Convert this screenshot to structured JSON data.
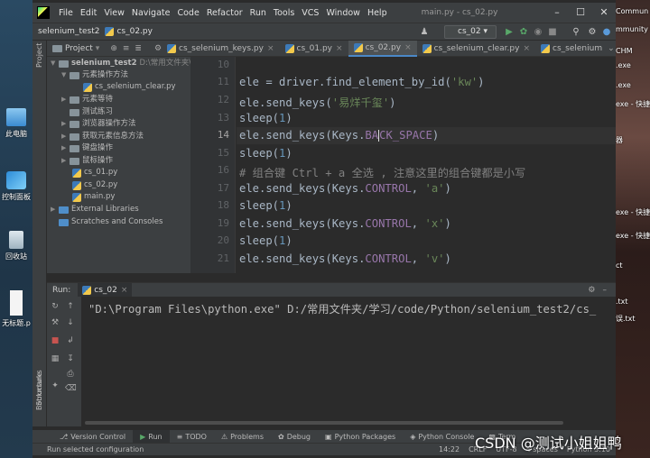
{
  "desktop": {
    "icons": [
      {
        "label": "此电脑"
      },
      {
        "label": "控制面板"
      },
      {
        "label": "回收站"
      },
      {
        "label": "无标题.p"
      }
    ],
    "right_snippets": [
      "Commun",
      "mmunity I",
      "CHM",
      ".exe",
      ".exe",
      "exe - 快捷方",
      "器",
      "exe - 快捷方",
      "exe - 快捷方",
      "ct",
      ".txt",
      "误.txt"
    ]
  },
  "window": {
    "title": "main.py - cs_02.py",
    "menu": [
      "File",
      "Edit",
      "View",
      "Navigate",
      "Code",
      "Refactor",
      "Run",
      "Tools",
      "VCS",
      "Window",
      "Help"
    ]
  },
  "nav": {
    "project": "selenium_test2",
    "file": "cs_02.py",
    "run_config": "cs_02"
  },
  "tabs": {
    "project_label": "Project",
    "editor_tabs": [
      "cs_selenium_keys.py",
      "cs_01.py",
      "cs_02.py",
      "cs_selenium_clear.py",
      "cs_selenium"
    ],
    "active": "cs_02.py"
  },
  "tree": {
    "root": "selenium_test2",
    "root_path": "D:\\常用文件夹\\学习",
    "items": [
      "元素操作方法",
      "cs_selenium_clear.py",
      "元素等待",
      "测试练习",
      "浏览器操作方法",
      "获取元素信息方法",
      "键盘操作",
      "鼠标操作",
      "cs_01.py",
      "cs_02.py",
      "main.py",
      "External Libraries",
      "Scratches and Consoles"
    ]
  },
  "editor": {
    "line_numbers": [
      "10",
      "11",
      "12",
      "13",
      "14",
      "15",
      "16",
      "17",
      "18",
      "19",
      "20",
      "21"
    ],
    "lines": [
      "",
      "ele = driver.find_element_by_id('kw')",
      "ele.send_keys('易烊千玺')",
      "sleep(1)",
      "ele.send_keys(Keys.BACK_SPACE)",
      "sleep(1)",
      "# 组合键 Ctrl + a 全选 , 注意这里的组合键都是小写",
      "ele.send_keys(Keys.CONTROL, 'a')",
      "sleep(1)",
      "ele.send_keys(Keys.CONTROL, 'x')",
      "sleep(1)",
      "ele.send_keys(Keys.CONTROL, 'v')"
    ],
    "current_line": "14"
  },
  "run": {
    "label": "Run:",
    "tab": "cs_02",
    "output": "\"D:\\Program Files\\python.exe\" D:/常用文件夹/学习/code/Python/selenium_test2/cs_"
  },
  "side_labels": {
    "project": "Project",
    "structure": "Structure",
    "bookmarks": "Bookmarks"
  },
  "bottom_tabs": [
    "Version Control",
    "Run",
    "TODO",
    "Problems",
    "Debug",
    "Python Packages",
    "Python Console",
    "Term"
  ],
  "status": {
    "left": "Run selected configuration",
    "position": "14:22",
    "line_sep": "CRLF",
    "encoding": "UTF-8",
    "indent": "4 spaces",
    "interpreter": "Python 3.10"
  },
  "watermark": "CSDN @测试小姐姐鸭"
}
